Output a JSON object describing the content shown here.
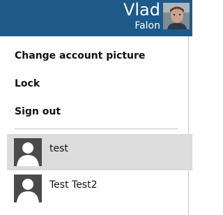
{
  "user": {
    "first_name": "Vlad",
    "last_name": "Falon",
    "avatar": "user-photo"
  },
  "menu": {
    "items": [
      {
        "label": "Change account picture"
      },
      {
        "label": "Lock"
      },
      {
        "label": "Sign out"
      }
    ]
  },
  "accounts": [
    {
      "label": "test",
      "avatar": "person-silhouette-icon",
      "selected": true
    },
    {
      "label": "Test Test2",
      "avatar": "person-silhouette-icon",
      "selected": false
    }
  ],
  "colors": {
    "header": "#1d5a8a",
    "selected_row": "#dcdcdc",
    "divider": "#c8c8c8"
  }
}
